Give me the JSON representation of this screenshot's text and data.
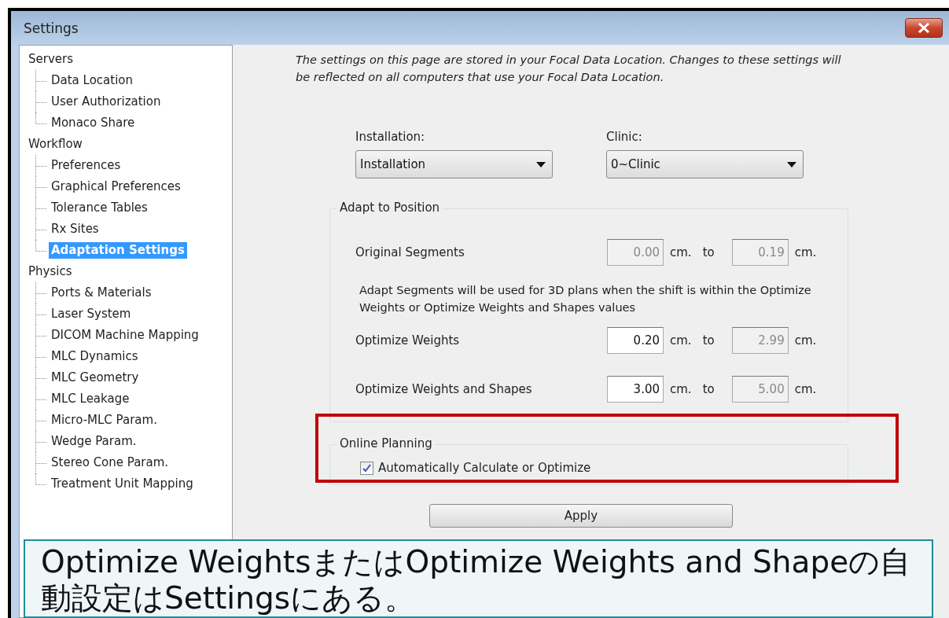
{
  "window": {
    "title": "Settings"
  },
  "tree": [
    {
      "label": "Servers",
      "selected": false,
      "children": [
        {
          "label": "Data Location",
          "selected": false
        },
        {
          "label": "User Authorization",
          "selected": false
        },
        {
          "label": "Monaco Share",
          "selected": false
        }
      ]
    },
    {
      "label": "Workflow",
      "selected": false,
      "children": [
        {
          "label": "Preferences",
          "selected": false
        },
        {
          "label": "Graphical Preferences",
          "selected": false
        },
        {
          "label": "Tolerance Tables",
          "selected": false
        },
        {
          "label": "Rx Sites",
          "selected": false
        },
        {
          "label": "Adaptation Settings",
          "selected": true
        }
      ]
    },
    {
      "label": "Physics",
      "selected": false,
      "children": [
        {
          "label": "Ports & Materials",
          "selected": false
        },
        {
          "label": "Laser System",
          "selected": false
        },
        {
          "label": "DICOM Machine Mapping",
          "selected": false
        },
        {
          "label": "MLC Dynamics",
          "selected": false
        },
        {
          "label": "MLC Geometry",
          "selected": false
        },
        {
          "label": "MLC Leakage",
          "selected": false
        },
        {
          "label": "Micro-MLC Param.",
          "selected": false
        },
        {
          "label": "Wedge Param.",
          "selected": false
        },
        {
          "label": "Stereo Cone Param.",
          "selected": false
        },
        {
          "label": "Treatment Unit Mapping",
          "selected": false
        }
      ]
    }
  ],
  "notice": "The settings on this page are stored in your Focal Data Location. Changes to these settings will be reflected on all computers that use your Focal Data Location.",
  "selectors": [
    {
      "label": "Installation:",
      "value": "Installation"
    },
    {
      "label": "Clinic:",
      "value": "0~Clinic"
    }
  ],
  "adapt_group": {
    "title": "Adapt to Position",
    "items": [
      {
        "kind": "range",
        "label": "Original Segments",
        "from": {
          "value": "0.00",
          "disabled": true
        },
        "from_unit": "cm.",
        "to_word": "to",
        "to": {
          "value": "0.19",
          "disabled": true
        },
        "to_unit": "cm."
      },
      {
        "kind": "note",
        "text": "Adapt Segments will be used for 3D plans when the shift is within the Optimize Weights or Optimize Weights and Shapes values"
      },
      {
        "kind": "range",
        "label": "Optimize Weights",
        "from": {
          "value": "0.20",
          "disabled": false
        },
        "from_unit": "cm.",
        "to_word": "to",
        "to": {
          "value": "2.99",
          "disabled": true
        },
        "to_unit": "cm."
      },
      {
        "kind": "range",
        "label": "Optimize Weights and Shapes",
        "from": {
          "value": "3.00",
          "disabled": false
        },
        "from_unit": "cm.",
        "to_word": "to",
        "to": {
          "value": "5.00",
          "disabled": true
        },
        "to_unit": "cm."
      }
    ]
  },
  "online_group": {
    "title": "Online Planning",
    "checkbox": {
      "label": "Automatically Calculate or Optimize",
      "checked": true
    }
  },
  "apply_button": "Apply",
  "callout": {
    "text": "Optimize WeightsまたはOptimize Weights and Shapeの自動設定はSettingsにある。"
  }
}
